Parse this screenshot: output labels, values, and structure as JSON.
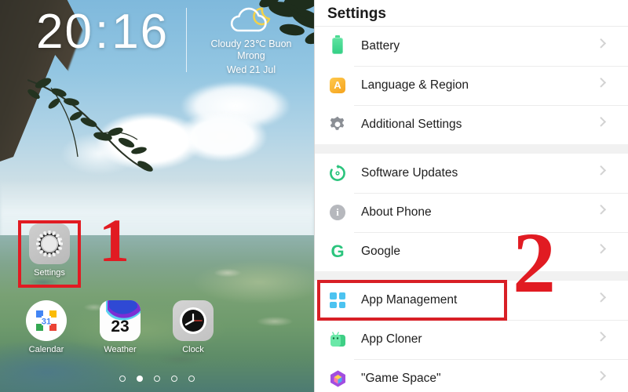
{
  "home": {
    "clock": {
      "hours": "20",
      "separator": ":",
      "minutes": "16"
    },
    "weather": {
      "icon": "cloud-moon-icon",
      "condition_line": "Cloudy 23℃  Buon\nMrong",
      "date_line": "Wed 21 Jul"
    },
    "apps": [
      {
        "name": "settings",
        "label": "Settings",
        "icon": "settings-gear-icon"
      },
      {
        "name": "calendar",
        "label": "Calendar",
        "icon": "calendar-icon",
        "day_number": "31"
      },
      {
        "name": "weather",
        "label": "Weather",
        "icon": "weather-icon",
        "temperature": "23"
      },
      {
        "name": "clock",
        "label": "Clock",
        "icon": "analog-clock-icon"
      }
    ],
    "page_dots": {
      "count": 5,
      "active_index": 1
    },
    "annotation": {
      "number": "1",
      "highlight": "settings-app-icon"
    }
  },
  "settings": {
    "title": "Settings",
    "groups": [
      {
        "rows": [
          {
            "label": "Battery",
            "icon": "battery-icon",
            "color": "#3ad18a"
          },
          {
            "label": "Language & Region",
            "icon": "language-icon",
            "color": "#f5a31d",
            "glyph": "A"
          },
          {
            "label": "Additional Settings",
            "icon": "gear-icon",
            "color": "#8b8f95"
          }
        ]
      },
      {
        "rows": [
          {
            "label": "Software Updates",
            "icon": "software-update-icon",
            "color": "#2bc47d"
          },
          {
            "label": "About Phone",
            "icon": "info-icon",
            "color": "#b6b8bd",
            "glyph": "i"
          },
          {
            "label": "Google",
            "icon": "google-g-icon",
            "color": "#2bc47d",
            "glyph": "G"
          }
        ]
      },
      {
        "rows": [
          {
            "label": "App Management",
            "icon": "app-management-icon",
            "color": "#4cc3f0",
            "highlighted": true
          },
          {
            "label": "App Cloner",
            "icon": "app-cloner-icon",
            "color": "#4fd98e"
          },
          {
            "label": "\"Game Space\"",
            "icon": "game-space-icon",
            "color": "#a24de0"
          }
        ]
      }
    ],
    "chevron": "chevron-right-icon",
    "annotation": {
      "number": "2",
      "highlight": "App Management"
    }
  },
  "colors": {
    "annotation_red": "#e11b22",
    "highlight_red": "#d81f26",
    "row_text": "#1d1d1d",
    "group_bg": "#f1f1f1"
  }
}
